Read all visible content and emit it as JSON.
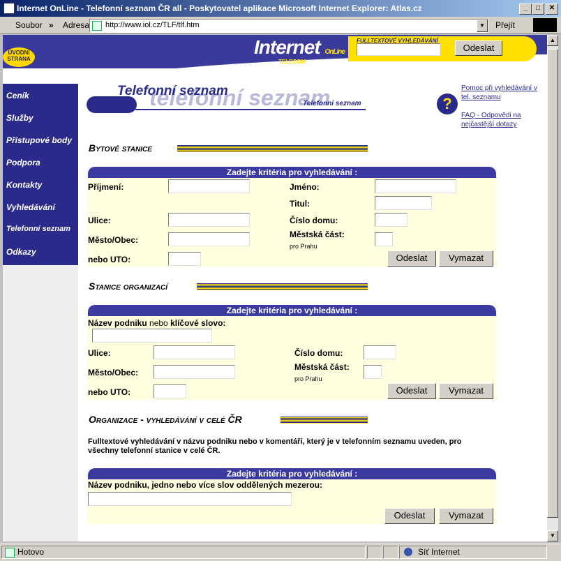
{
  "window": {
    "title": "Internet OnLine - Telefonní seznam ČR all - Poskytovatel aplikace Microsoft Internet Explorer: Atlas.cz",
    "minimize": "_",
    "maximize": "□",
    "close": "✕"
  },
  "toolbar": {
    "file_menu": "Soubor",
    "chevron": "»",
    "address_label": "Adresa",
    "address_value": "http://www.iol.cz/TLF/tlf.htm",
    "go_label": "Přejít"
  },
  "status": {
    "text": "Hotovo",
    "zone": "Síť Internet"
  },
  "header": {
    "logo_main": "Internet",
    "logo_sub": "OnLine",
    "logo_telecom": "TELECOM",
    "fulltext_label": "FULLTEXTOVÉ VYHLEDÁVÁNÍ",
    "send": "Odeslat",
    "home_badge": "ÚVODNÍ STRANA"
  },
  "sidebar": {
    "items": [
      {
        "label": "Ceník"
      },
      {
        "label": "Služby"
      },
      {
        "label": "Přístupové body"
      },
      {
        "label": "Podpora"
      },
      {
        "label": "Kontakty"
      },
      {
        "label": "Vyhledávání"
      },
      {
        "label": "Telefonní seznam"
      },
      {
        "label": "Odkazy"
      }
    ]
  },
  "brand": {
    "title": "Telefonní seznam",
    "ghost": "telefonní seznam",
    "small": "Telefonní seznam"
  },
  "help": {
    "icon": "?",
    "link1": "Pomoc při vyhledávání v tel. seznamu",
    "link2": "FAQ - Odpovědi na nejčastější dotazy"
  },
  "sections": {
    "bytove": {
      "title": "Bytové stanice",
      "header": "Zadejte kritéria pro vyhledávání :",
      "prijmeni": "Příjmení:",
      "jmeno": "Jméno:",
      "titul": "Titul:",
      "ulice": "Ulice:",
      "cislo_domu": "Číslo domu:",
      "mesto": "Město/Obec:",
      "mestska_cast": "Městská část:",
      "pro_prahu": "pro Prahu",
      "uto": "nebo UTO:",
      "send": "Odeslat",
      "clear": "Vymazat"
    },
    "organizace": {
      "title": "Stanice organizací",
      "header": "Zadejte kritéria pro vyhledávání :",
      "nazev_a": "Název podniku",
      "nazev_b": " nebo ",
      "nazev_c": "klíčové slovo:",
      "ulice": "Ulice:",
      "cislo_domu": "Číslo domu:",
      "mesto": "Město/Obec:",
      "mestska_cast": "Městská část:",
      "pro_prahu": "pro Prahu",
      "uto": "nebo UTO:",
      "send": "Odeslat",
      "clear": "Vymazat"
    },
    "celecr": {
      "title": "Organizace - vyhledávání v celé ČR",
      "desc": "Fulltextové vyhledávání v názvu podniku nebo v komentáři, který je v telefonním seznamu uveden, pro všechny telefonní stanice v celé ČR.",
      "header": "Zadejte kritéria pro vyhledávání :",
      "nazev": "Název podniku, jedno nebo více slov oddělených mezerou:",
      "send": "Odeslat",
      "clear": "Vymazat"
    }
  },
  "colors": {
    "navy": "#2a2a8a",
    "yellow": "#ffe000",
    "panel_bg": "#ffffe0"
  }
}
